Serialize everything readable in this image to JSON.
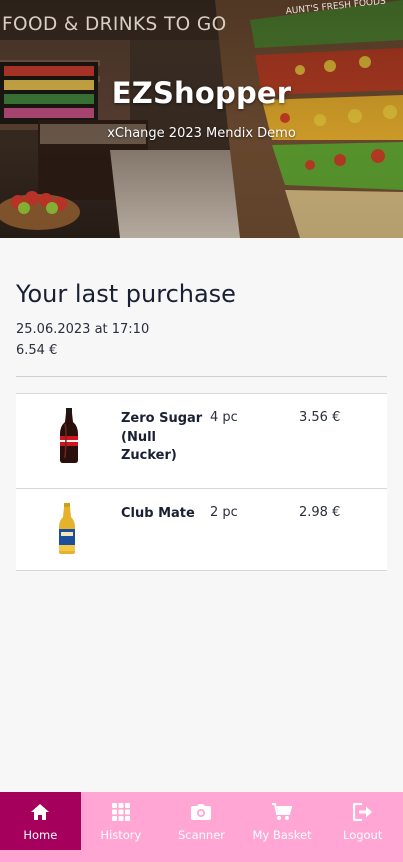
{
  "hero": {
    "store_sign": "FOOD & DRINKS TO GO",
    "shelf_sign": "AUNT'S FRESH FOODS",
    "app_title": "EZShopper",
    "subtitle": "xChange 2023 Mendix Demo"
  },
  "last_purchase": {
    "heading": "Your last purchase",
    "date": "25.06.2023 at 17:10",
    "total": "6.54 €",
    "items": [
      {
        "name": "Zero Sugar (Null Zucker)",
        "quantity": "4 pc",
        "price": "3.56 €",
        "image": "cola-bottle"
      },
      {
        "name": "Club Mate",
        "quantity": "2 pc",
        "price": "2.98 €",
        "image": "club-mate-bottle"
      }
    ]
  },
  "nav": {
    "items": [
      {
        "label": "Home",
        "icon": "home-icon",
        "active": true
      },
      {
        "label": "History",
        "icon": "grid-icon",
        "active": false
      },
      {
        "label": "Scanner",
        "icon": "camera-icon",
        "active": false
      },
      {
        "label": "My Basket",
        "icon": "cart-icon",
        "active": false
      },
      {
        "label": "Logout",
        "icon": "logout-icon",
        "active": false
      }
    ],
    "active_color": "#a5005b",
    "bar_color": "#ffa6d4"
  }
}
